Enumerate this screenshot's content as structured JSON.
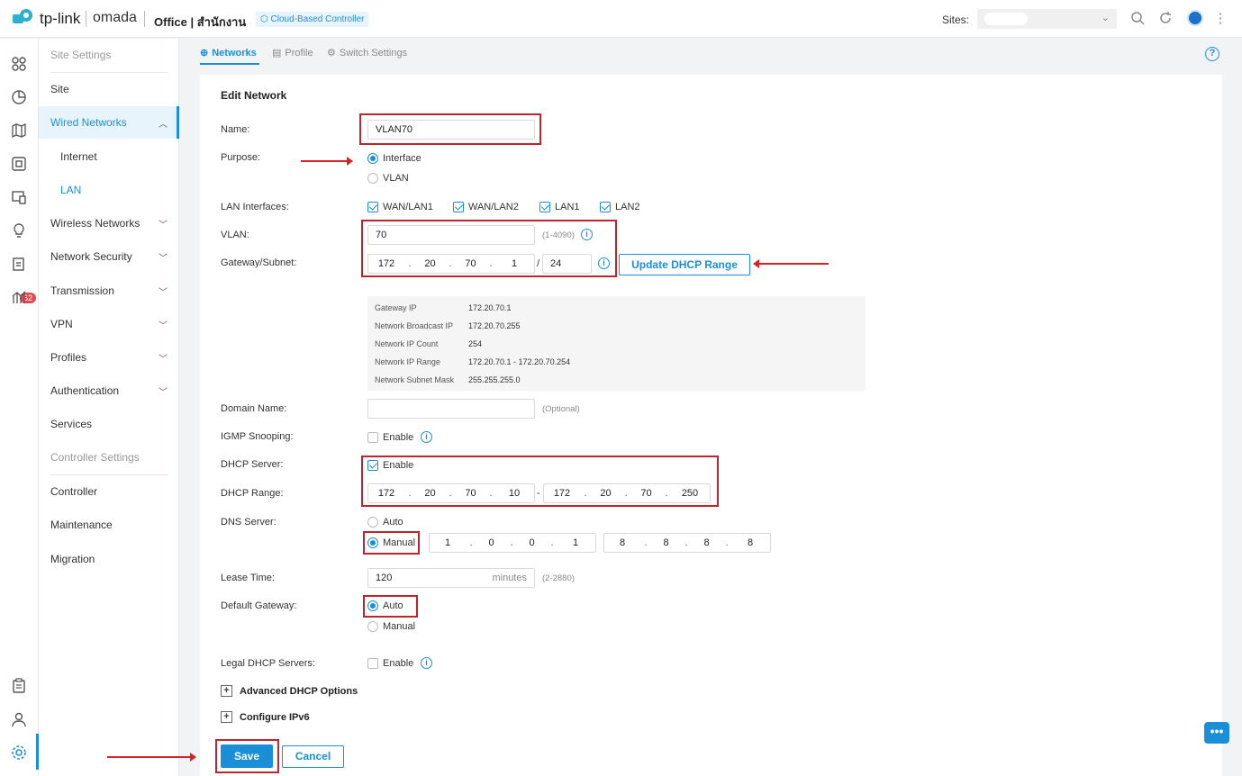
{
  "header": {
    "brand": "tp-link",
    "product": "omada",
    "site_title": "Office | สำนักงาน",
    "cloud_badge": "Cloud-Based Controller",
    "sites_label": "Sites:"
  },
  "nav": {
    "site_settings": "Site Settings",
    "site": "Site",
    "wired_networks": "Wired Networks",
    "internet": "Internet",
    "lan": "LAN",
    "wireless_networks": "Wireless Networks",
    "network_security": "Network Security",
    "transmission": "Transmission",
    "vpn": "VPN",
    "profiles": "Profiles",
    "authentication": "Authentication",
    "services": "Services",
    "controller_settings": "Controller Settings",
    "controller": "Controller",
    "maintenance": "Maintenance",
    "migration": "Migration"
  },
  "rail": {
    "badge_count": "62"
  },
  "tabs": {
    "networks": "Networks",
    "profile": "Profile",
    "switch_settings": "Switch Settings"
  },
  "form": {
    "title": "Edit Network",
    "name_label": "Name:",
    "name_value": "VLAN70",
    "purpose_label": "Purpose:",
    "purpose_interface": "Interface",
    "purpose_vlan": "VLAN",
    "lan_interfaces_label": "LAN Interfaces:",
    "lan_if": [
      "WAN/LAN1",
      "WAN/LAN2",
      "LAN1",
      "LAN2"
    ],
    "vlan_label": "VLAN:",
    "vlan_value": "70",
    "vlan_hint": "(1-4090)",
    "gateway_label": "Gateway/Subnet:",
    "gateway_octets": [
      "172",
      "20",
      "70",
      "1"
    ],
    "subnet_slash": "/",
    "subnet_value": "24",
    "update_dhcp_button": "Update DHCP Range",
    "info_box": [
      {
        "k": "Gateway IP",
        "v": "172.20.70.1"
      },
      {
        "k": "Network Broadcast IP",
        "v": "172.20.70.255"
      },
      {
        "k": "Network IP Count",
        "v": "254"
      },
      {
        "k": "Network IP Range",
        "v": "172.20.70.1 - 172.20.70.254"
      },
      {
        "k": "Network Subnet Mask",
        "v": "255.255.255.0"
      }
    ],
    "domain_label": "Domain Name:",
    "domain_hint": "(Optional)",
    "igmp_label": "IGMP Snooping:",
    "enable": "Enable",
    "dhcp_server_label": "DHCP Server:",
    "dhcp_range_label": "DHCP Range:",
    "dhcp_start": [
      "172",
      "20",
      "70",
      "10"
    ],
    "range_dash": "-",
    "dhcp_end": [
      "172",
      "20",
      "70",
      "250"
    ],
    "dns_label": "DNS Server:",
    "auto": "Auto",
    "manual": "Manual",
    "dns1": [
      "1",
      "0",
      "0",
      "1"
    ],
    "dns2": [
      "8",
      "8",
      "8",
      "8"
    ],
    "lease_label": "Lease Time:",
    "lease_value": "120",
    "lease_unit": "minutes",
    "lease_hint": "(2-2880)",
    "default_gw_label": "Default Gateway:",
    "legal_dhcp_label": "Legal DHCP Servers:",
    "advanced_dhcp": "Advanced DHCP Options",
    "configure_ipv6": "Configure IPv6",
    "save": "Save",
    "cancel": "Cancel"
  },
  "colors": {
    "accent": "#1a8fd8",
    "annotation_red": "#c0232b"
  }
}
